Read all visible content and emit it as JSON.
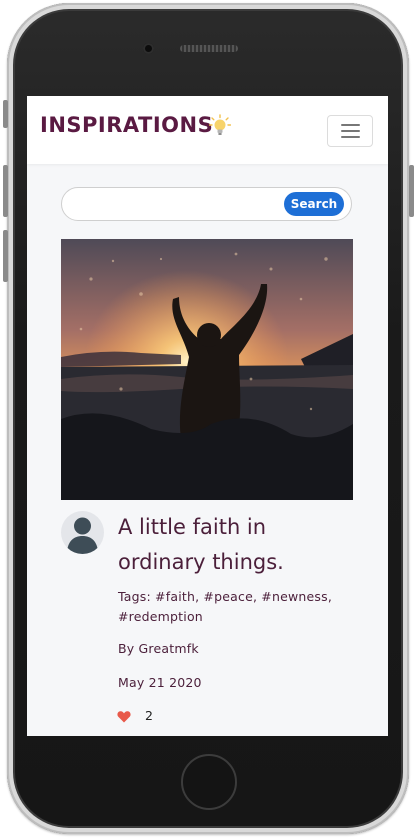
{
  "app": {
    "brand": "INSPIRATIONS",
    "brand_color": "#5a1a42"
  },
  "search": {
    "value": "",
    "placeholder": "",
    "button_label": "Search",
    "button_color": "#1e6fd6"
  },
  "post": {
    "image_description_icon": "image-placeholder",
    "title": "A little faith in ordinary things.",
    "tags_line": "Tags: #faith, #peace, #newness, #redemption",
    "author_line": "By Greatmfk",
    "date": "May 21 2020",
    "likes": "2",
    "like_icon": "heart-icon",
    "like_color": "#e8594a",
    "text_color": "#4b1f3a"
  }
}
